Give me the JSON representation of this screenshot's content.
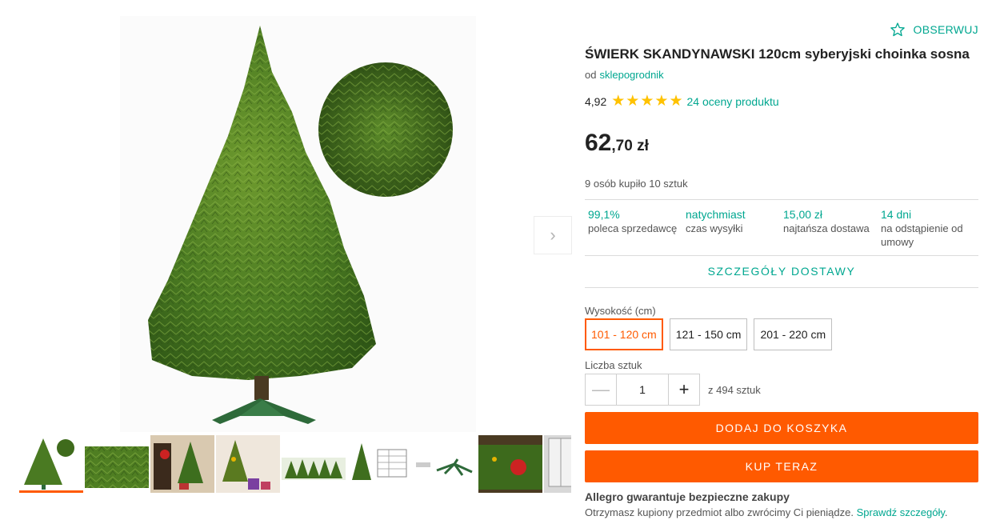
{
  "gallery": {
    "next_icon": "chevron-right-icon",
    "thumbnails": [
      {
        "name": "thumb-tree-with-detail",
        "active": true
      },
      {
        "name": "thumb-branch-closeup",
        "active": false
      },
      {
        "name": "thumb-decorated-room",
        "active": false
      },
      {
        "name": "thumb-tree-with-gifts",
        "active": false
      },
      {
        "name": "thumb-tree-row",
        "active": false
      },
      {
        "name": "thumb-size-table",
        "active": false
      },
      {
        "name": "thumb-stand-parts",
        "active": false
      },
      {
        "name": "thumb-decorating",
        "active": false
      },
      {
        "name": "thumb-window",
        "active": false
      }
    ]
  },
  "product": {
    "watch_label": "OBSERWUJ",
    "watch_icon": "star-outline-icon",
    "title": "ŚWIERK SKANDYNAWSKI 120cm syberyjski choinka sosna",
    "seller_prefix": "od",
    "seller_name": "sklepogrodnik",
    "rating_value": "4,92",
    "rating_stars": 5,
    "rating_count": "24 oceny produktu",
    "price_main": "62",
    "price_rest": ",70 zł",
    "sold_info": "9 osób kupiło 10 sztuk"
  },
  "features": [
    {
      "value": "99,1%",
      "label": "poleca sprzedawcę"
    },
    {
      "value": "natychmiast",
      "label": "czas wysyłki"
    },
    {
      "value": "15,00 zł",
      "label": "najtańsza dostawa"
    },
    {
      "value": "14 dni",
      "label": "na odstąpienie od umowy"
    }
  ],
  "delivery_link": "SZCZEGÓŁY DOSTAWY",
  "height_selector": {
    "label": "Wysokość (cm)",
    "options": [
      "101 - 120 cm",
      "121 - 150 cm",
      "201 - 220 cm"
    ],
    "selected": "101 - 120 cm"
  },
  "quantity": {
    "label": "Liczba sztuk",
    "value": "1",
    "availability": "z 494 sztuk",
    "minus_symbol": "—",
    "plus_symbol": "+"
  },
  "buttons": {
    "add_to_cart": "DODAJ DO KOSZYKA",
    "buy_now": "KUP TERAZ"
  },
  "guarantee": {
    "title": "Allegro gwarantuje bezpieczne zakupy",
    "text": "Otrzymasz kupiony przedmiot albo zwrócimy Ci pieniądze.",
    "link": "Sprawdź szczegóły",
    "suffix": "."
  },
  "colors": {
    "accent": "#ff5a00",
    "link": "#00a790",
    "star": "#ffc200",
    "tree": "#3e6e1e"
  }
}
